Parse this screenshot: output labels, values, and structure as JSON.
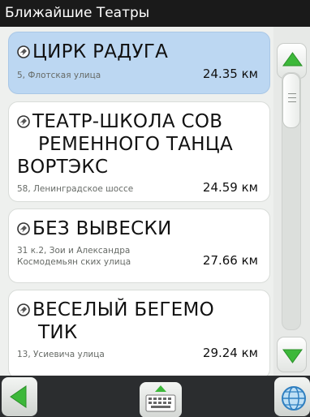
{
  "window": {
    "title": "Ближайшие Театры"
  },
  "colors": {
    "selected_card": "#bcd7f2",
    "accent_green": "#3db83a",
    "title_bar": "#1a1a1a",
    "bottom_bar": "#2b2d2f"
  },
  "places": [
    {
      "title_lines": [
        "ЦИРК РАДУГА"
      ],
      "address": "5, Флотская улица",
      "distance": "24.35 км",
      "selected": true
    },
    {
      "title_lines": [
        "ТЕАТР-ШКОЛА СОВ",
        "РЕМЕННОГО ТАНЦА",
        "ВОРТЭКС"
      ],
      "address": "58, Ленинградское шоссе",
      "distance": "24.59 км",
      "selected": false
    },
    {
      "title_lines": [
        "БЕЗ ВЫВЕСКИ"
      ],
      "address": "31 к.2, Зои и Александра Космодемьян ских улица",
      "distance": "27.66 км",
      "selected": false
    },
    {
      "title_lines": [
        "ВЕСЕЛЫЙ БЕГЕМО",
        "ТИК"
      ],
      "address": "13, Усиевича улица",
      "distance": "29.24 км",
      "selected": false
    }
  ],
  "scrollbar": {
    "position_fraction": 0.0
  },
  "icons": {
    "scroll_up": "up-arrow-icon",
    "scroll_down": "down-arrow-icon",
    "back": "back-arrow-icon",
    "keyboard": "keyboard-icon",
    "globe": "globe-icon",
    "place": "place-pin-icon"
  }
}
